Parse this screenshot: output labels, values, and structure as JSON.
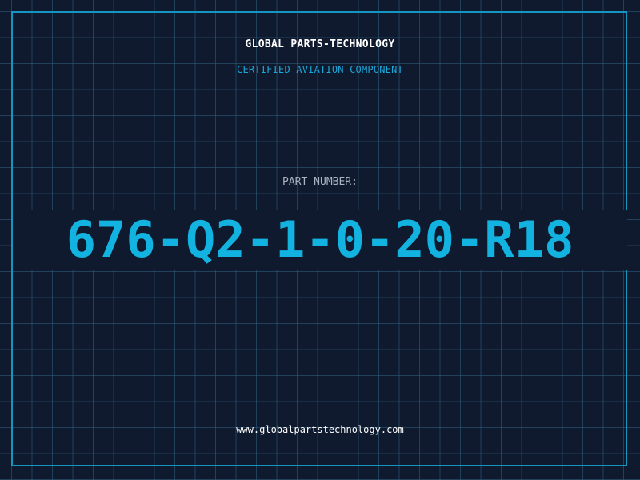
{
  "header": {
    "company": "GLOBAL PARTS-TECHNOLOGY",
    "tagline": "CERTIFIED AVIATION COMPONENT"
  },
  "part": {
    "label": "PART NUMBER:",
    "number": "676-Q2-1-0-20-R18"
  },
  "footer": {
    "website": "www.globalpartstechnology.com"
  },
  "colors": {
    "background": "#101a2e",
    "grid": "#306082",
    "frame": "#1596c2",
    "accent": "#12b3e0",
    "label": "#a9b4c4",
    "text": "#ffffff"
  }
}
